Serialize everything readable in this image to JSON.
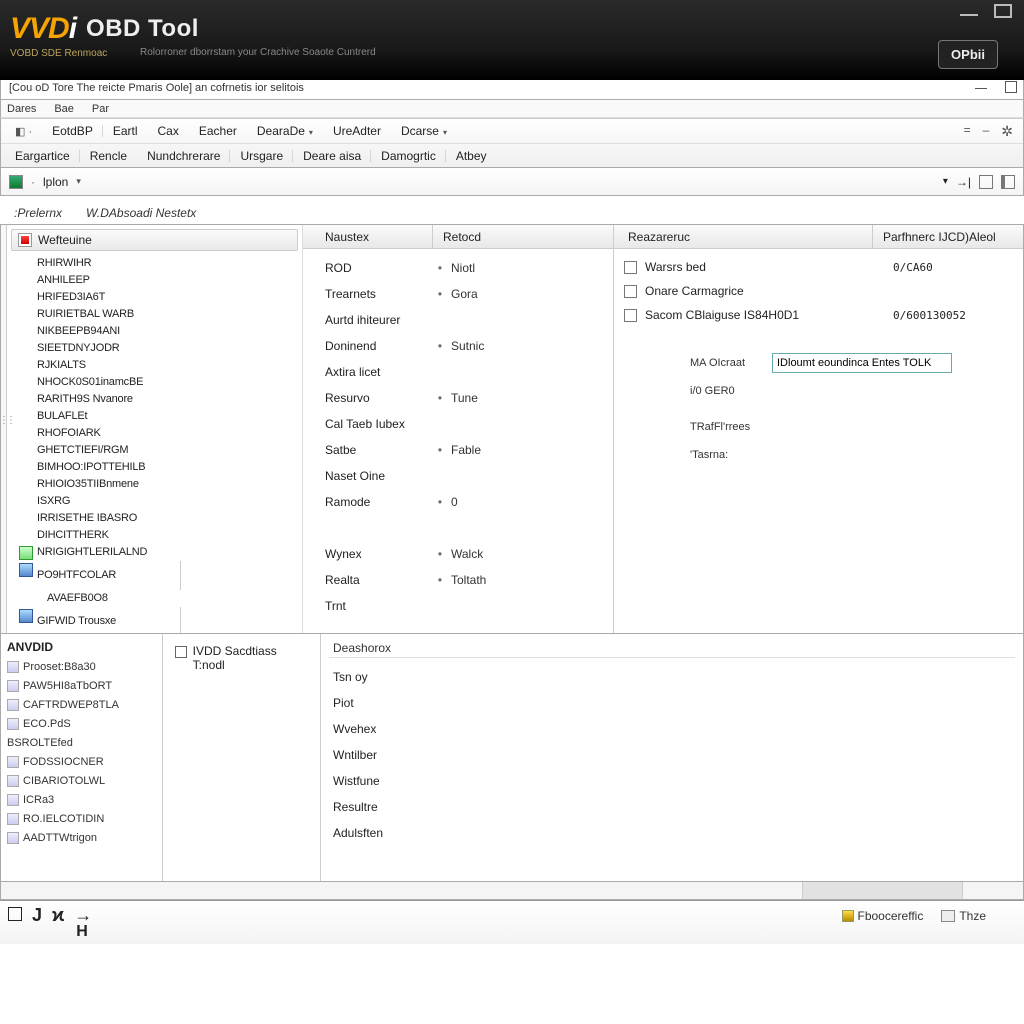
{
  "banner": {
    "logo_prefix": "VVD",
    "logo_suffix": "i",
    "title_rest": "OBD Tool",
    "sub1": "VOBD SDE Renmoac",
    "sub2": "Rolorroner dborrstam your Crachive Soaote Cuntrerd",
    "btn": "OPbii"
  },
  "titlebar": {
    "text": "[Cou oD Tore The reicte Pmaris Oole]  an cofrnetis ior selitois"
  },
  "menurow1": {
    "a": "Dares",
    "b": "Bae",
    "c": "Par"
  },
  "ribbon": {
    "r1": [
      "EotdBP",
      "Eartl",
      "Cax",
      "Eacher",
      "DearaDe",
      "UreAdter",
      "Dcarse"
    ],
    "r2": [
      "Eargartice",
      "Rencle",
      "Nundchrerare",
      "Ursgare",
      "Deare aisa",
      "Damogrtic",
      "Atbey"
    ]
  },
  "subbar": {
    "sel": "lplon"
  },
  "tabs": {
    "a": ":Prelernx",
    "b": "W.DAbsoadi Nestetx"
  },
  "tree": {
    "head": "Wefteuine",
    "items": [
      "RHIRWIHR",
      "ANHILEEP",
      "HRIFED3IA6T",
      "RUIRIETBAL WARB",
      "NIKBEEPB94ANI",
      "SIEETDNYJODR",
      "RJKIALTS",
      "NHOCK0S01inamcBE",
      "RARITH9S Nvanore",
      "BULAFLEt",
      "RHOFOIARK",
      "GHETCTIEFI/RGM",
      "BIMHOO:IPOTTEHILB",
      "RHIOIO35TIIBnmene",
      "ISXRG",
      "IRRISETHE IBASRO",
      "DIHCITTHERK"
    ],
    "ic1": "NRIGIGHTLERILALND",
    "ic2": "PO9HTFCOLAR",
    "ic2b": "AVAEFB0O8",
    "last": "GIFWID Trousxe"
  },
  "mid": {
    "h1": "Naustex",
    "h2": "Retocd",
    "rows": [
      {
        "k": "ROD",
        "c": "Niotl"
      },
      {
        "k": "Trearnets",
        "c": "Gora"
      },
      {
        "k": "Aurtd ihiteurer",
        "c": ""
      },
      {
        "k": "Doninend",
        "c": "Sutnic"
      },
      {
        "k": "Axtira licet",
        "c": ""
      },
      {
        "k": "Resurvo",
        "c": "Tune"
      },
      {
        "k": "Cal Taeb Iubex",
        "c": ""
      },
      {
        "k": "Satbe",
        "c": "Fable"
      },
      {
        "k": "Naset Oine",
        "c": ""
      },
      {
        "k": "Ramode",
        "c": "0"
      },
      {
        "k": "",
        "c": ""
      },
      {
        "k": "Wynex",
        "c": "Walck"
      },
      {
        "k": "Realta",
        "c": "Toltath"
      },
      {
        "k": "Trnt",
        "c": ""
      }
    ]
  },
  "right": {
    "h1": "Reazareruc",
    "h2": "Parfhnerc IJCD)Aleol",
    "checks": [
      {
        "l": "Warsrs bed",
        "v": "0/CA60"
      },
      {
        "l": "Onare Carmagrice",
        "v": ""
      },
      {
        "l": "Sacom CBlaiguse IS84H0D1",
        "v": "0/600130052"
      }
    ],
    "form": {
      "f1l": "MA OIcraat",
      "f1v": "IDloumt eoundinca Entes TOLK",
      "f2l": "i/0 GER0",
      "f3l": "TRafFl'rrees",
      "f4l": "'Tasrna:"
    }
  },
  "bleft": {
    "title": "ANVDID",
    "items": [
      "Prooset:B8a30",
      "PAW5HI8aTbORT",
      "CAFTRDWEP8TLA",
      "ECO.PdS"
    ],
    "plain": "BSROLTEfed",
    "items2": [
      "FODSSIOCNER",
      "CIBARIOTOLWL",
      "ICRa3",
      "RO.IELCOTIDIN",
      "AADTTWtrigon"
    ]
  },
  "bcenter": {
    "chk": "IVDD Sacdtiass T:nodl"
  },
  "bright": {
    "head": "Deashorox",
    "items": [
      "Tsn oy",
      "Piot",
      "Wvehex",
      "Wntilber",
      "Wistfune",
      "Resultre",
      "Adulsften"
    ]
  },
  "tray": {
    "a": "Fboocereffic",
    "b": "Thze"
  }
}
